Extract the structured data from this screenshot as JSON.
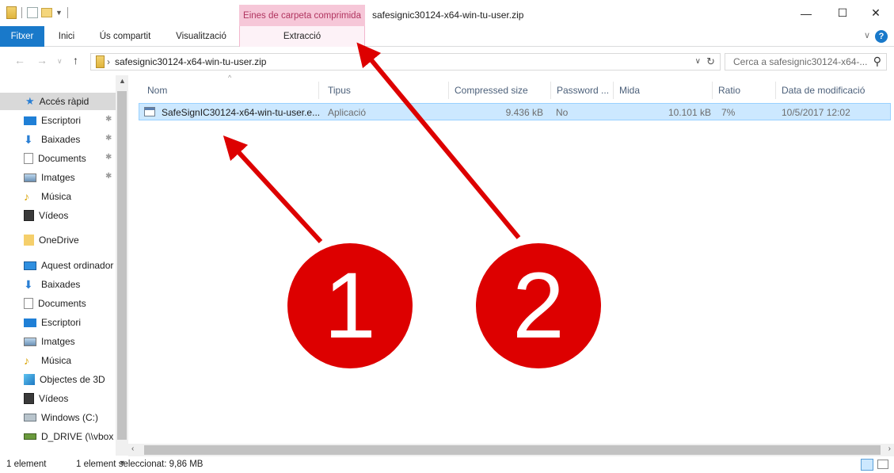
{
  "titlebar": {
    "contextual_group": "Eines de carpeta comprimida",
    "window_title": "safesignic30124-x64-win-tu-user.zip",
    "minimize": "—",
    "maximize": "☐",
    "close": "✕"
  },
  "ribbon": {
    "tabs": [
      "Fitxer",
      "Inici",
      "Ús compartit",
      "Visualització",
      "Extracció"
    ]
  },
  "address": {
    "path": "safesignic30124-x64-win-tu-user.zip",
    "search_placeholder": "Cerca a safesignic30124-x64-..."
  },
  "navpane": {
    "quick_access": "Accés ràpid",
    "quick_items": [
      "Escriptori",
      "Baixades",
      "Documents",
      "Imatges",
      "Música",
      "Vídeos"
    ],
    "onedrive": "OneDrive",
    "this_pc": "Aquest ordinador",
    "pc_items": [
      "Baixades",
      "Documents",
      "Escriptori",
      "Imatges",
      "Música",
      "Objectes de 3D",
      "Vídeos",
      "Windows (C:)",
      "D_DRIVE (\\\\vbox"
    ]
  },
  "columns": [
    "Nom",
    "Tipus",
    "Compressed size",
    "Password ...",
    "Mida",
    "Ratio",
    "Data de modificació"
  ],
  "files": [
    {
      "name": "SafeSignIC30124-x64-win-tu-user.e...",
      "type": "Aplicació",
      "compressed": "9.436 kB",
      "password": "No",
      "size": "10.101 kB",
      "ratio": "7%",
      "modified": "10/5/2017 12:02"
    }
  ],
  "status": {
    "count": "1 element",
    "selected": "1 element seleccionat: 9,86 MB"
  },
  "annotations": [
    "1",
    "2"
  ],
  "colors": {
    "accent": "#1979ca",
    "annotation": "#dd0000",
    "selection": "#cce8ff",
    "context_tab": "#f6c7d8"
  }
}
